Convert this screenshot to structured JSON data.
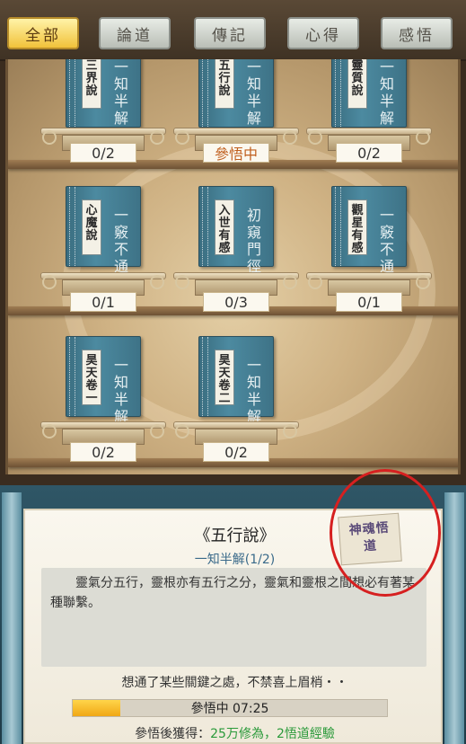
{
  "tabs": [
    {
      "label": "全部",
      "active": true
    },
    {
      "label": "論道",
      "active": false
    },
    {
      "label": "傳記",
      "active": false
    },
    {
      "label": "心得",
      "active": false
    },
    {
      "label": "感悟",
      "active": false
    }
  ],
  "books": [
    {
      "title": "三界說",
      "level": "一知半解",
      "count": "0/2",
      "status": ""
    },
    {
      "title": "五行說",
      "level": "一知半解",
      "count": "",
      "status": "參悟中"
    },
    {
      "title": "靈質說",
      "level": "一知半解",
      "count": "0/2",
      "status": ""
    },
    {
      "title": "心魔說",
      "level": "一竅不通",
      "count": "0/1",
      "status": ""
    },
    {
      "title": "入世有感",
      "level": "初窺門徑",
      "count": "0/3",
      "status": ""
    },
    {
      "title": "觀星有感",
      "level": "一竅不通",
      "count": "0/1",
      "status": ""
    },
    {
      "title": "昊天卷一",
      "level": "一知半解",
      "count": "0/2",
      "status": ""
    },
    {
      "title": "昊天卷二",
      "level": "一知半解",
      "count": "0/2",
      "status": ""
    }
  ],
  "detail": {
    "title": "《五行說》",
    "level": "一知半解(1/2)",
    "seal": "神魂悟道",
    "description": "靈氣分五行，靈根亦有五行之分，靈氣和靈根之間想必有著某種聯繫。",
    "quote": "想通了某些關鍵之處，不禁喜上眉梢・・",
    "progress_label": "參悟中 07:25",
    "progress": 0.15,
    "reward_label": "參悟後獲得：",
    "reward_value": "25万修為，2悟道經驗"
  },
  "colors": {
    "accent": "#f1c23a",
    "highlight": "#d62020",
    "reward": "#2a9a3a"
  }
}
